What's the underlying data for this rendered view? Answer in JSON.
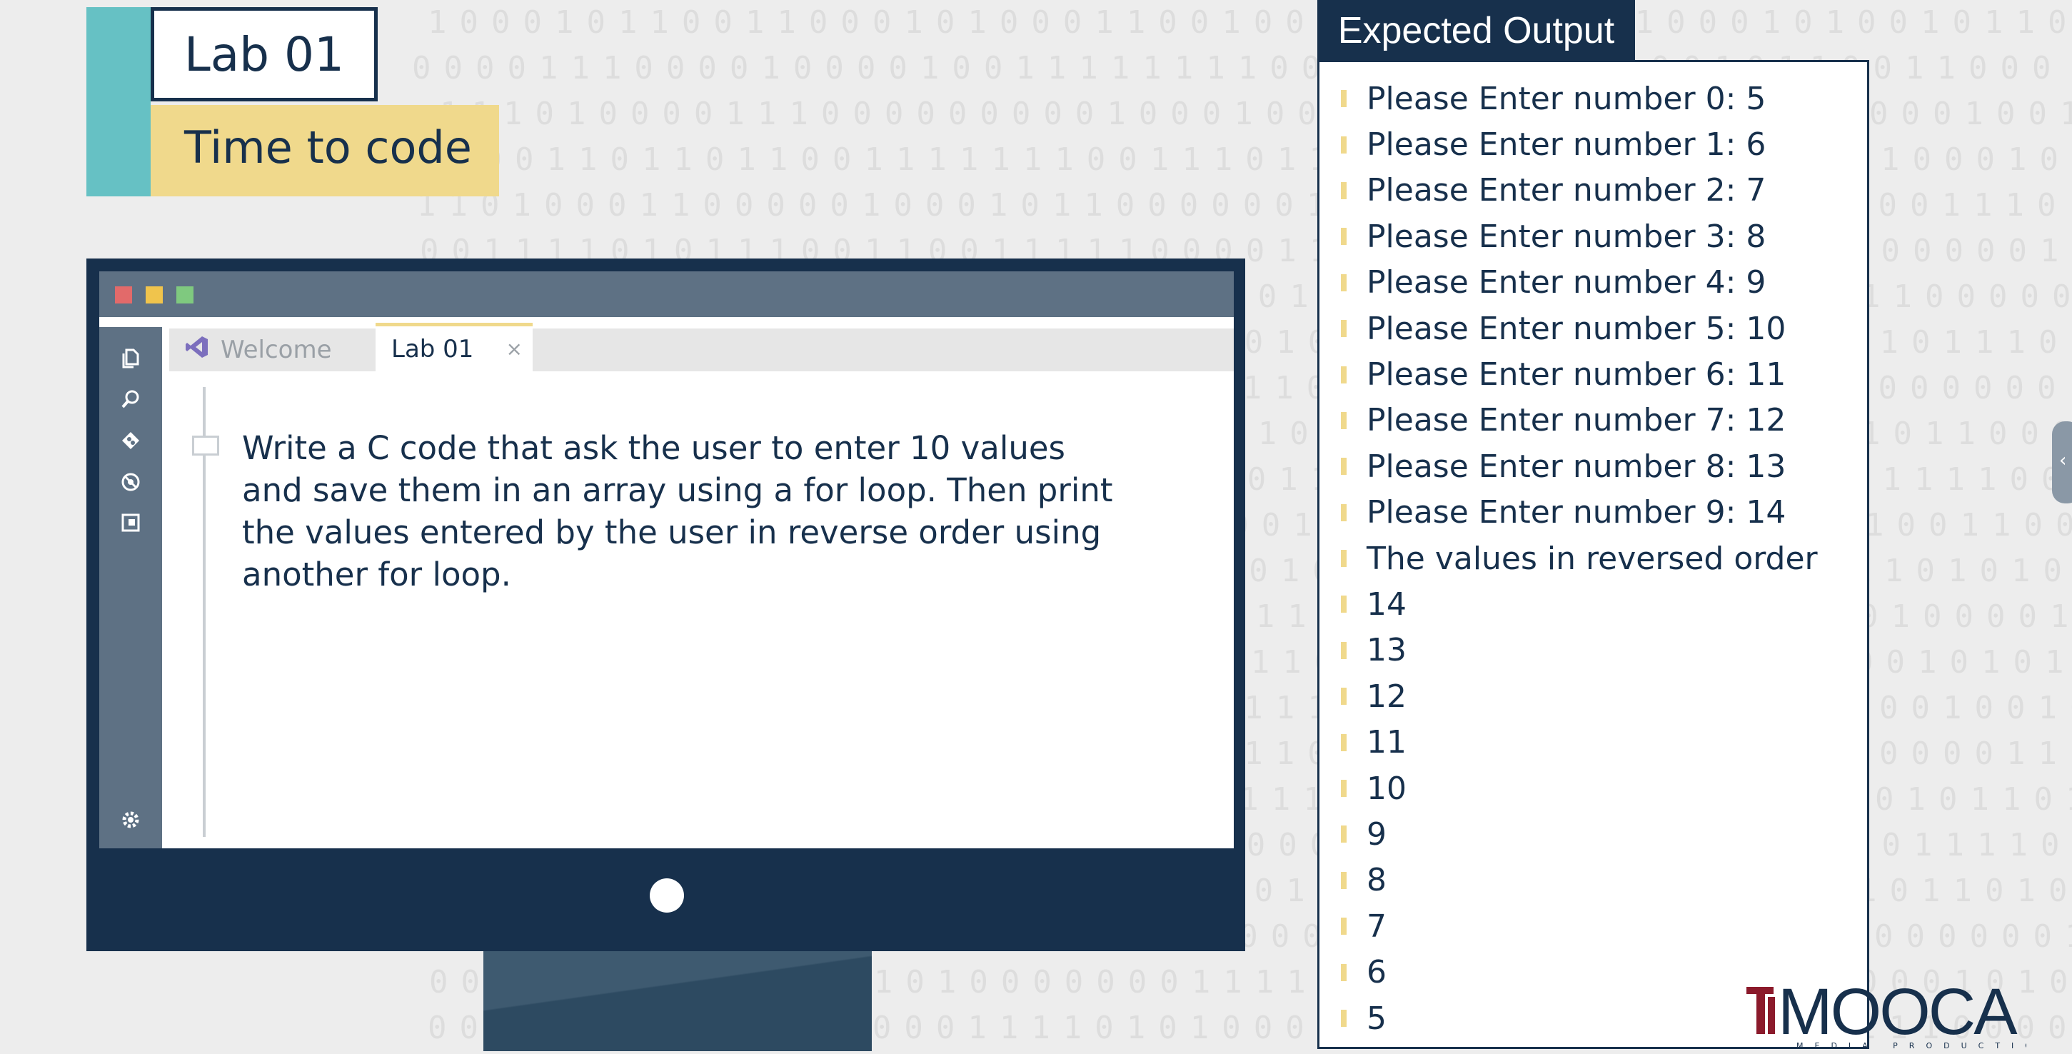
{
  "title_block": {
    "lab_label": "Lab 01",
    "subtitle": "Time to code"
  },
  "editor": {
    "window_controls": [
      {
        "name": "close",
        "color": "#e26a6a"
      },
      {
        "name": "minimize",
        "color": "#f0c44c"
      },
      {
        "name": "maximize",
        "color": "#7fc97f"
      }
    ],
    "activity_icons": [
      "files-icon",
      "search-icon",
      "source-control-icon",
      "debug-icon",
      "extensions-icon",
      "settings-icon"
    ],
    "tabs": [
      {
        "label": "Welcome",
        "active": false
      },
      {
        "label": "Lab 01",
        "active": true,
        "close_glyph": "×"
      }
    ],
    "instruction": "Write a C code that ask the user to enter 10 values and save them in an array using a for loop. Then print the values entered by the user in reverse order using another for loop."
  },
  "expected_output": {
    "header": "Expected Output",
    "lines": [
      "Please Enter number 0: 5",
      "Please Enter number 1: 6",
      "Please Enter number 2: 7",
      "Please Enter number 3: 8",
      "Please Enter number 4: 9",
      "Please Enter number 5: 10",
      "Please Enter number 6: 11",
      "Please Enter number 7: 12",
      "Please Enter number 8: 13",
      "Please Enter number 9: 14",
      "The values in reversed order",
      "14",
      "13",
      "12",
      "11",
      "10",
      "9",
      "8",
      "7",
      "6",
      "5"
    ]
  },
  "logo": {
    "name": "MOOCA",
    "tagline": "MEDIA PRODUCTION"
  },
  "colors": {
    "navy": "#17304c",
    "teal": "#66c1c4",
    "yellow": "#f0d98c",
    "slate": "#5e7184"
  }
}
